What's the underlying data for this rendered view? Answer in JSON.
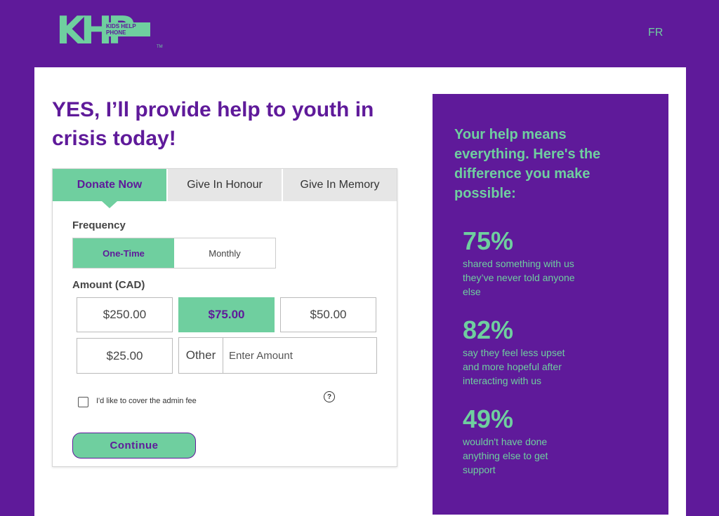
{
  "header": {
    "logo_mark": "KHP",
    "logo_text": "KIDS HELP PHONE",
    "logo_tm": "TM",
    "lang_toggle": "FR"
  },
  "headline": "YES, I’ll provide help to youth in crisis today!",
  "form": {
    "tabs": [
      {
        "label": "Donate Now",
        "active": true
      },
      {
        "label": "Give In Honour",
        "active": false
      },
      {
        "label": "Give In Memory",
        "active": false
      }
    ],
    "frequency_label": "Frequency",
    "frequency_options": [
      {
        "label": "One-Time",
        "active": true
      },
      {
        "label": "Monthly",
        "active": false
      }
    ],
    "amount_label": "Amount (CAD)",
    "amounts": [
      {
        "label": "$250.00",
        "active": false
      },
      {
        "label": "$75.00",
        "active": true
      },
      {
        "label": "$50.00",
        "active": false
      },
      {
        "label": "$25.00",
        "active": false
      }
    ],
    "other_label": "Other",
    "other_placeholder": "Enter Amount",
    "admin_fee_label": "I'd like to cover the admin fee",
    "help_symbol": "?",
    "continue_label": "Continue"
  },
  "sidebar": {
    "title": "Your help means everything. Here's the difference you make possible:",
    "stats": [
      {
        "value": "75%",
        "desc": "shared something with us they’ve never told anyone else"
      },
      {
        "value": "82%",
        "desc": "say they feel less upset and more hopeful after interacting with us"
      },
      {
        "value": "49%",
        "desc": "wouldn't have done anything else to get support"
      }
    ]
  },
  "colors": {
    "brand_purple": "#5f1a9a",
    "brand_green": "#6fcf9f"
  }
}
